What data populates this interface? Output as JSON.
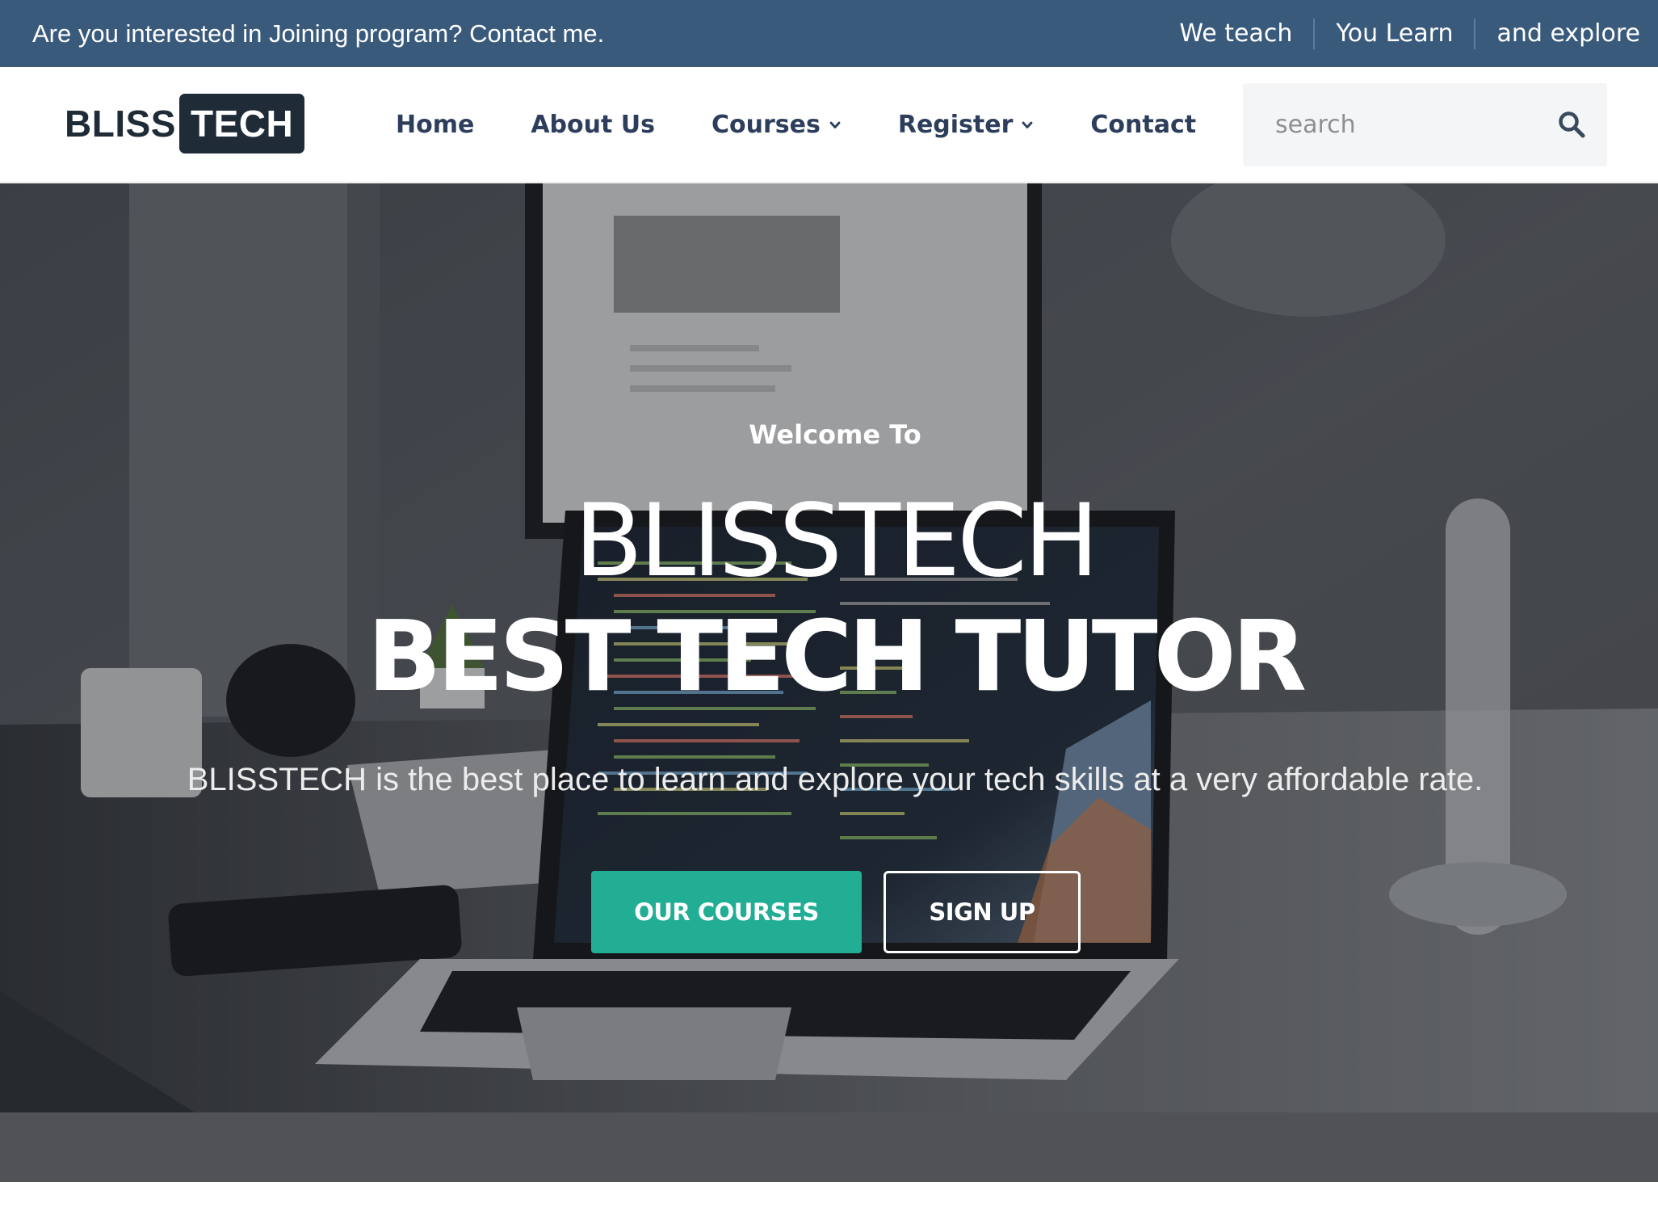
{
  "topbar": {
    "message": "Are you interested in Joining program? Contact me.",
    "links": [
      {
        "label": "We teach"
      },
      {
        "label": "You Learn"
      },
      {
        "label": "and explore"
      }
    ]
  },
  "logo": {
    "part1": "BLISS",
    "part2": "TECH"
  },
  "nav": {
    "items": [
      {
        "label": "Home"
      },
      {
        "label": "About Us"
      },
      {
        "label": "Courses"
      },
      {
        "label": "Register"
      },
      {
        "label": "Contact"
      }
    ]
  },
  "search": {
    "placeholder": "search",
    "icon": "search-icon"
  },
  "hero": {
    "welcome": "Welcome To",
    "brand": "BLISSTECH",
    "tagline": "BEST TECH TUTOR",
    "description": "BLISSTECH is the best place to learn and explore your tech skills at a very affordable rate.",
    "primary_button": "OUR COURSES",
    "secondary_button": "SIGN UP"
  },
  "colors": {
    "topbar": "#3a5a7c",
    "accent": "#21ae94",
    "nav_text": "#2d3d5c",
    "logo_dark": "#1f2b36"
  }
}
